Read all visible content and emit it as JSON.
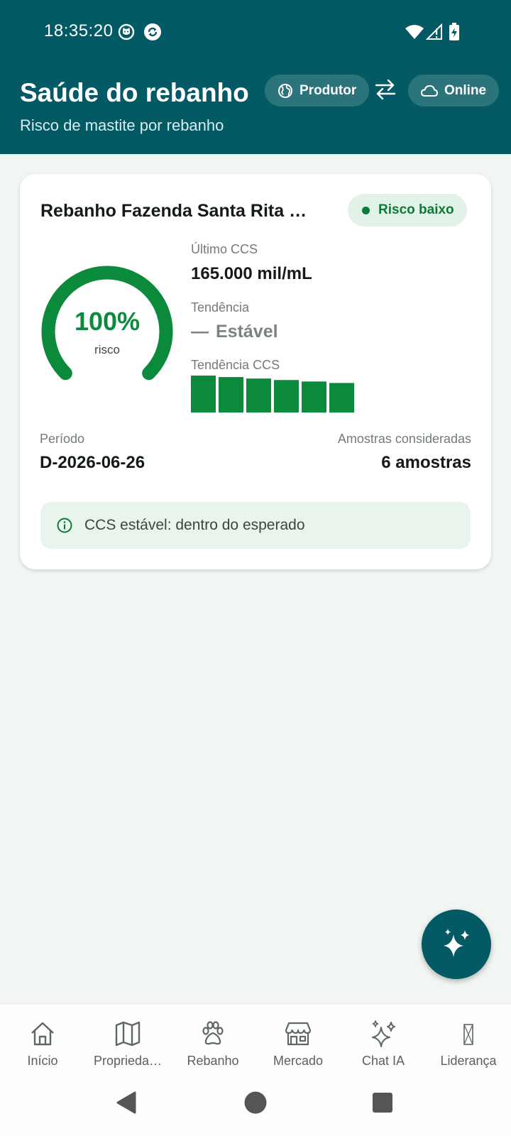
{
  "status_bar": {
    "time": "18:35:20",
    "left_icons": [
      "cat-notification-icon",
      "sync-app-icon"
    ],
    "right_icons": [
      "wifi-icon",
      "cell-signal-icon",
      "battery-charging-icon"
    ]
  },
  "header": {
    "title": "Saúde do rebanho",
    "subtitle": "Risco de mastite por rebanho",
    "profile_chip": {
      "icon": "globe-icon",
      "label": "Produtor"
    },
    "swap_icon": "swap-arrows-icon",
    "status_chip": {
      "icon": "cloud-icon",
      "label": "Online"
    },
    "color": "#045a64"
  },
  "card": {
    "title": "Rebanho Fazenda Santa Rita — …",
    "badge": "Risco baixo",
    "gauge": {
      "percent": 100,
      "text": "100%",
      "label": "risco",
      "color": "#0b8a3c"
    },
    "ultimo_ccs": {
      "label": "Último CCS",
      "value": "165.000 mil/mL"
    },
    "tendencia": {
      "label": "Tendência",
      "symbol": "—",
      "value": "Estável"
    },
    "tendencia_ccs": {
      "label": "Tendência CCS",
      "bar_levels": [
        1.0,
        0.96,
        0.92,
        0.88,
        0.84,
        0.8
      ],
      "color": "#0b8a3c"
    },
    "periodo": {
      "label": "Período",
      "value": "D-2026-06-26"
    },
    "amostras": {
      "label": "Amostras consideradas",
      "value": "6 amostras"
    },
    "info": {
      "icon": "info-icon",
      "text": "CCS estável: dentro do esperado"
    }
  },
  "fab": {
    "icon": "sparkles-icon"
  },
  "bottom_nav": [
    {
      "name": "nav-inicio",
      "icon": "home-icon",
      "label": "Início"
    },
    {
      "name": "nav-propriedades",
      "icon": "map-icon",
      "label": "Proprieda…"
    },
    {
      "name": "nav-rebanho",
      "icon": "paw-icon",
      "label": "Rebanho"
    },
    {
      "name": "nav-mercado",
      "icon": "store-icon",
      "label": "Mercado"
    },
    {
      "name": "nav-chat-ia",
      "icon": "sparkles-icon",
      "label": "Chat IA"
    },
    {
      "name": "nav-lideranca",
      "icon": "missing-glyph-icon",
      "label": "Liderança"
    }
  ],
  "system_nav": [
    "back-icon",
    "home-circle-icon",
    "recents-icon"
  ]
}
